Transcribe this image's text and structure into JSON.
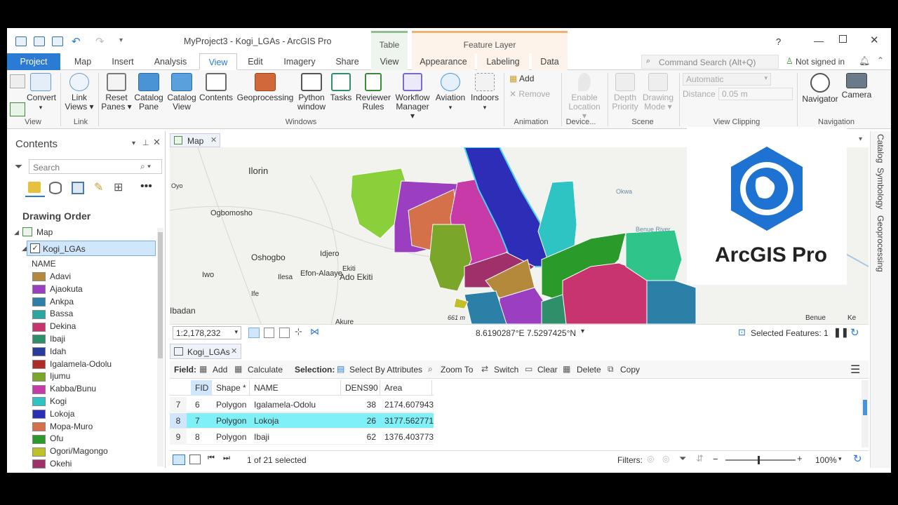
{
  "window": {
    "title": "MyProject3 - Kogi_LGAs - ArcGIS Pro",
    "help": "?",
    "ctx_table": "Table",
    "ctx_feature_layer": "Feature Layer"
  },
  "tabs": [
    "Project",
    "Map",
    "Insert",
    "Analysis",
    "View",
    "Edit",
    "Imagery",
    "Share",
    "View",
    "Appearance",
    "Labeling",
    "Data"
  ],
  "command_search": {
    "placeholder": "Command Search (Alt+Q)"
  },
  "signin": "Not signed in",
  "ribbon": {
    "convert": "Convert",
    "link_views_1": "Link",
    "link_views_2": "Views",
    "reset_panes_1": "Reset",
    "reset_panes_2": "Panes",
    "catalog_pane_1": "Catalog",
    "catalog_pane_2": "Pane",
    "catalog_view_1": "Catalog",
    "catalog_view_2": "View",
    "contents": "Contents",
    "geoprocessing": "Geoprocessing",
    "python_1": "Python",
    "python_2": "window",
    "tasks": "Tasks",
    "reviewer_1": "Reviewer",
    "reviewer_2": "Rules",
    "workflow_1": "Workflow",
    "workflow_2": "Manager",
    "aviation": "Aviation",
    "indoors": "Indoors",
    "add": "Add",
    "remove": "Remove",
    "enable_1": "Enable",
    "enable_2": "Location",
    "depth_1": "Depth",
    "depth_2": "Priority",
    "drawing_1": "Drawing",
    "drawing_2": "Mode",
    "automatic": "Automatic",
    "distance_label": "Distance",
    "distance_value": "0.05  m",
    "navigator": "Navigator",
    "camera": "Camera",
    "groups": [
      "View",
      "Link",
      "Windows",
      "Animation",
      "Device...",
      "Scene",
      "View Clipping",
      "Navigation"
    ]
  },
  "contents": {
    "title": "Contents",
    "search_placeholder": "Search",
    "drawing_order": "Drawing Order",
    "map": "Map",
    "layer": "Kogi_LGAs",
    "field": "NAME",
    "legend": [
      {
        "name": "Adavi",
        "color": "#b5893c"
      },
      {
        "name": "Ajaokuta",
        "color": "#9b3fc0"
      },
      {
        "name": "Ankpa",
        "color": "#2c7fa6"
      },
      {
        "name": "Bassa",
        "color": "#2aa7a0"
      },
      {
        "name": "Dekina",
        "color": "#c8356e"
      },
      {
        "name": "Ibaji",
        "color": "#2f8f6a"
      },
      {
        "name": "Idah",
        "color": "#2a3b9e"
      },
      {
        "name": "Igalamela-Odolu",
        "color": "#b02a2a"
      },
      {
        "name": "Ijumu",
        "color": "#7aa62a"
      },
      {
        "name": "Kabba/Bunu",
        "color": "#c83aa8"
      },
      {
        "name": "Kogi",
        "color": "#2ec4c4"
      },
      {
        "name": "Lokoja",
        "color": "#2d2db8"
      },
      {
        "name": "Mopa-Muro",
        "color": "#d4704a"
      },
      {
        "name": "Ofu",
        "color": "#2a9a2a"
      },
      {
        "name": "Ogori/Magongo",
        "color": "#c0c02a"
      },
      {
        "name": "Okehi",
        "color": "#a0306a"
      }
    ]
  },
  "map": {
    "tab": "Map",
    "places": [
      "Ilorin",
      "Oyo",
      "Ogbomosho",
      "Oshogbo",
      "Idjero",
      "Iwo",
      "Efon-Alaaye",
      "Ekiti",
      "Ado Ekiti",
      "Ilesa",
      "Ife",
      "Ibadan",
      "Akure",
      "Okwa",
      "Benue River",
      "Benue",
      "661 m",
      "Ke"
    ],
    "scale": "1:2,178,232",
    "coords": "8.6190287°E 7.5297425°N",
    "selected_features": "Selected Features: 1"
  },
  "logo": {
    "text": "ArcGIS Pro"
  },
  "right_panels": [
    "Catalog",
    "Symbology",
    "Geoprocessing"
  ],
  "table": {
    "tab": "Kogi_LGAs",
    "field_label": "Field:",
    "add": "Add",
    "calculate": "Calculate",
    "selection_label": "Selection:",
    "select_by_attr": "Select By Attributes",
    "zoom_to": "Zoom To",
    "switch": "Switch",
    "clear": "Clear",
    "delete": "Delete",
    "copy": "Copy",
    "columns": [
      "FID",
      "Shape *",
      "NAME",
      "DENS90",
      "Area"
    ],
    "rows": [
      {
        "idx": "7",
        "fid": "6",
        "shape": "Polygon",
        "name": "Igalamela-Odolu",
        "dens": "38",
        "area": "2174.607943"
      },
      {
        "idx": "8",
        "fid": "7",
        "shape": "Polygon",
        "name": "Lokoja",
        "dens": "26",
        "area": "3177.562771"
      },
      {
        "idx": "9",
        "fid": "8",
        "shape": "Polygon",
        "name": "Ibaji",
        "dens": "62",
        "area": "1376.403773"
      }
    ],
    "selected_count": "1 of 21 selected",
    "filters": "Filters:",
    "zoom": "100%"
  }
}
